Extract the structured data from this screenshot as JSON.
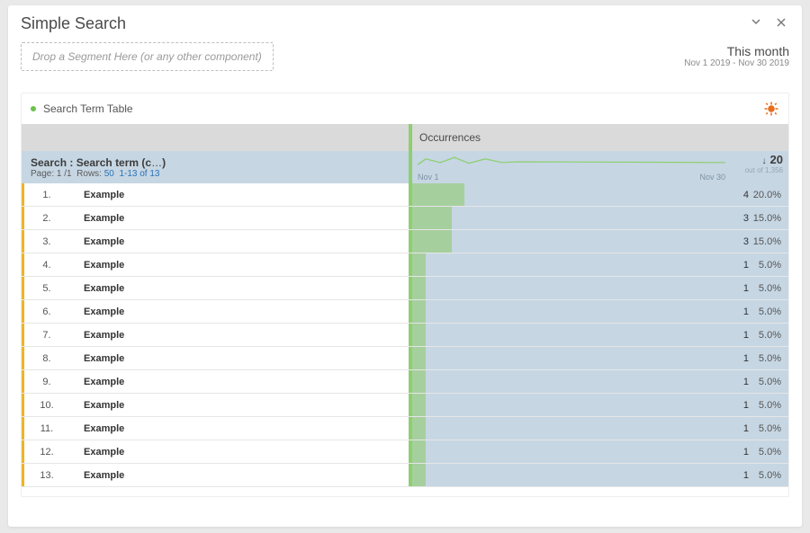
{
  "header": {
    "title": "Simple Search",
    "segment_placeholder": "Drop a Segment Here (or any other component)",
    "period_title": "This month",
    "period_range": "Nov 1 2019 - Nov 30 2019"
  },
  "panel": {
    "title": "Search Term Table",
    "column_left_label": "",
    "column_right_label": "Occurrences",
    "dimension": {
      "label_prefix": "Search :",
      "label_name": "Search term (c",
      "label_suffix": ")",
      "page_label": "Page:",
      "page": "1 /1",
      "rows_label": "Rows:",
      "rows": "50",
      "range": "1-13 of 13"
    },
    "spark": {
      "start": "Nov 1",
      "end": "Nov 30"
    },
    "totals": {
      "value": "20",
      "hint": "out of 1,356"
    }
  },
  "chart_data": {
    "type": "bar",
    "title": "Occurrences by Search term",
    "xlabel": "Search term",
    "ylabel": "Occurrences",
    "total": 20,
    "series": [
      {
        "idx": "1.",
        "label": "Example",
        "value": 4,
        "pct": "20.0%"
      },
      {
        "idx": "2.",
        "label": "Example",
        "value": 3,
        "pct": "15.0%"
      },
      {
        "idx": "3.",
        "label": "Example",
        "value": 3,
        "pct": "15.0%"
      },
      {
        "idx": "4.",
        "label": "Example",
        "value": 1,
        "pct": "5.0%"
      },
      {
        "idx": "5.",
        "label": "Example",
        "value": 1,
        "pct": "5.0%"
      },
      {
        "idx": "6.",
        "label": "Example",
        "value": 1,
        "pct": "5.0%"
      },
      {
        "idx": "7.",
        "label": "Example",
        "value": 1,
        "pct": "5.0%"
      },
      {
        "idx": "8.",
        "label": "Example",
        "value": 1,
        "pct": "5.0%"
      },
      {
        "idx": "9.",
        "label": "Example",
        "value": 1,
        "pct": "5.0%"
      },
      {
        "idx": "10.",
        "label": "Example",
        "value": 1,
        "pct": "5.0%"
      },
      {
        "idx": "11.",
        "label": "Example",
        "value": 1,
        "pct": "5.0%"
      },
      {
        "idx": "12.",
        "label": "Example",
        "value": 1,
        "pct": "5.0%"
      },
      {
        "idx": "13.",
        "label": "Example",
        "value": 1,
        "pct": "5.0%"
      }
    ]
  }
}
